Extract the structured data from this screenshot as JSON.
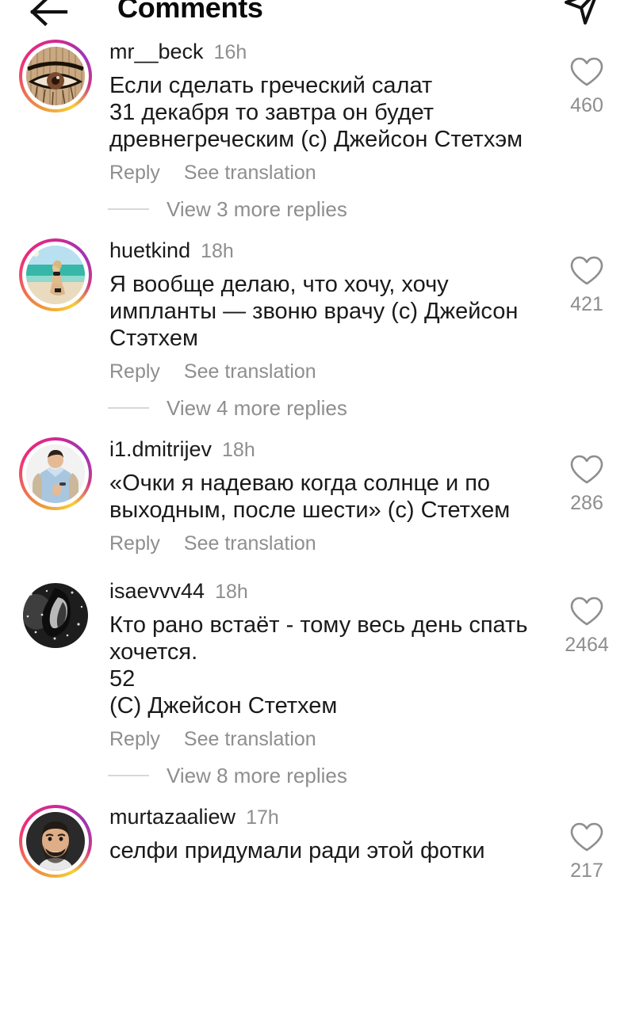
{
  "app": "instagram",
  "header": {
    "title": "Comments",
    "back_icon": "arrow-left-icon",
    "share_icon": "paper-plane-icon"
  },
  "colors": {
    "background": "#ffffff",
    "primary_text": "#1a1a1a",
    "secondary_text": "#8e8e8e",
    "divider": "#d8d8d8",
    "ring_gradient_start": "#f9ce34",
    "ring_gradient_mid": "#ee2a7b",
    "ring_gradient_end": "#9b36b7"
  },
  "actions": {
    "reply_label": "Reply",
    "see_translation_label": "See translation"
  },
  "comments": [
    {
      "username": "mr__beck",
      "timestamp": "16h",
      "text": "Если сделать греческий салат\n31 декабря то завтра он будет\nдревнегреческим (с) Джейсон Стетхэм",
      "likes": "460",
      "avatar": "eye-drawing-avatar",
      "has_story_ring": true,
      "replies_label": "View 3 more replies"
    },
    {
      "username": "huetkind",
      "timestamp": "18h",
      "text": "Я вообще делаю, что хочу, хочу\nимпланты — звоню врачу (с) Джейсон\nСтэтхем",
      "likes": "421",
      "avatar": "beach-photo-avatar",
      "has_story_ring": true,
      "replies_label": "View 4 more replies"
    },
    {
      "username": "i1.dmitrijev",
      "timestamp": "18h",
      "text": "«Очки я надеваю когда солнце и по\nвыходным, после шести» (с) Стетхем",
      "likes": "286",
      "avatar": "man-blue-shirt-avatar",
      "has_story_ring": true,
      "replies_label": ""
    },
    {
      "username": "isaevvv44",
      "timestamp": "18h",
      "text": "Кто рано встаёт - тому весь день спать\nхочется.\n52\n(С) Джейсон Стетхем",
      "likes": "2464",
      "avatar": "dark-monochrome-avatar",
      "has_story_ring": false,
      "replies_label": "View 8 more replies"
    },
    {
      "username": "murtazaaliew",
      "timestamp": "17h",
      "text": "селфи придумали ради этой фотки",
      "likes": "217",
      "avatar": "smiling-man-avatar",
      "has_story_ring": true,
      "replies_label": ""
    }
  ]
}
